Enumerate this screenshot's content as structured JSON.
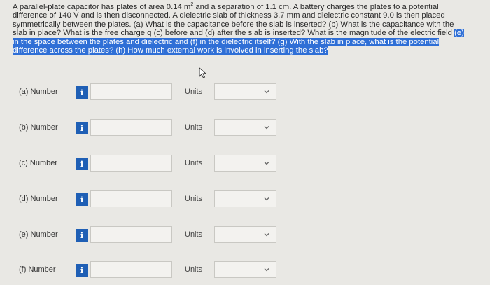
{
  "problem": {
    "part1": "A parallel-plate capacitor has plates of area 0.14 m",
    "sup": "2",
    "part2": " and a separation of 1.1 cm. A battery charges the plates to a potential difference of 140 V and is then disconnected. A dielectric slab of thickness 3.7 mm and dielectric constant 9.0 is then placed symmetrically between the plates. (a) What is the capacitance before the slab is inserted? (b) What is the capacitance with the slab in place? What is the free charge q (c) before and (d) after the slab is inserted? What is the magnitude of the electric field ",
    "highlighted": "(e) in the space between the plates and dielectric and (f) in the dielectric itself? (g) With the slab in place, what is the potential difference across the plates? (h) How much external work is involved in inserting the slab?"
  },
  "rows": [
    {
      "label": "(a)   Number",
      "info": "i",
      "units_label": "Units",
      "value": "",
      "unit": ""
    },
    {
      "label": "(b)   Number",
      "info": "i",
      "units_label": "Units",
      "value": "",
      "unit": ""
    },
    {
      "label": "(c)   Number",
      "info": "i",
      "units_label": "Units",
      "value": "",
      "unit": ""
    },
    {
      "label": "(d)   Number",
      "info": "i",
      "units_label": "Units",
      "value": "",
      "unit": ""
    },
    {
      "label": "(e)   Number",
      "info": "i",
      "units_label": "Units",
      "value": "",
      "unit": ""
    },
    {
      "label": "(f)   Number",
      "info": "i",
      "units_label": "Units",
      "value": "",
      "unit": ""
    }
  ],
  "colors": {
    "highlight": "#2f6fd6",
    "info_icon": "#1f5fb5"
  }
}
